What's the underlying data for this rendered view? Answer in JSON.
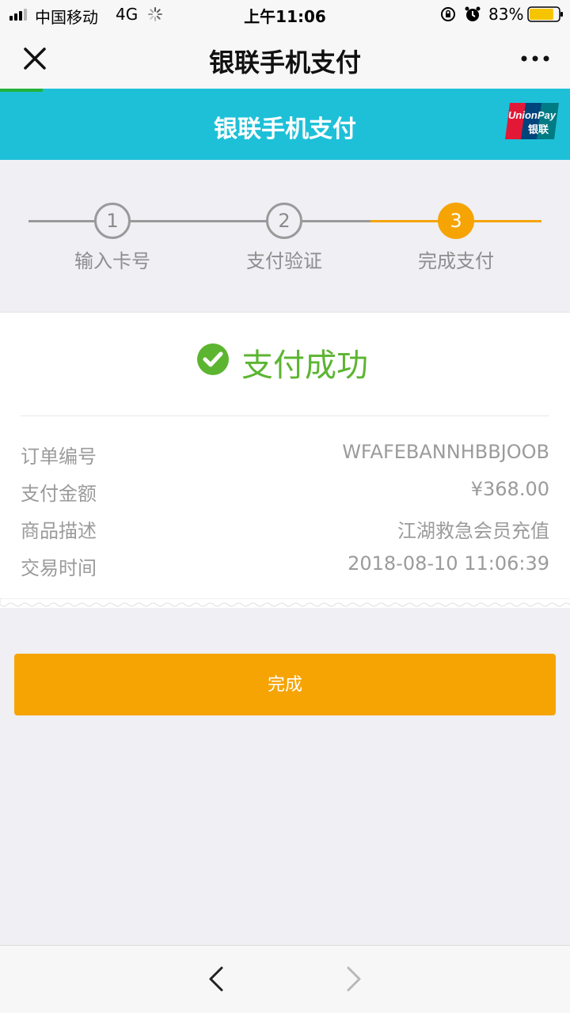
{
  "status_bar": {
    "carrier": "中国移动",
    "network": "4G",
    "time": "上午11:06",
    "battery_percent": "83%",
    "battery_level": 0.83
  },
  "nav": {
    "title": "银联手机支付",
    "close_icon": "close-icon",
    "more_icon": "more-dots-icon"
  },
  "banner": {
    "title": "银联手机支付",
    "logo_text": [
      "UnionPay",
      "银联"
    ],
    "logo_colors": [
      "#e21836",
      "#00447c",
      "#007b84"
    ]
  },
  "steps": [
    {
      "number": "1",
      "label": "输入卡号",
      "state": "done"
    },
    {
      "number": "2",
      "label": "支付验证",
      "state": "done"
    },
    {
      "number": "3",
      "label": "完成支付",
      "state": "active"
    }
  ],
  "result": {
    "status_text": "支付成功",
    "status_icon": "check-circle-icon",
    "rows": [
      {
        "label": "订单编号",
        "value": "WFAFEBANNHBBJOOB"
      },
      {
        "label": "支付金额",
        "value": "¥368.00"
      },
      {
        "label": "商品描述",
        "value": "江湖救急会员充值"
      },
      {
        "label": "交易时间",
        "value": "2018-08-10 11:06:39"
      }
    ]
  },
  "done_button": {
    "label": "完成"
  },
  "colors": {
    "banner": "#1ec0d8",
    "accent": "#f6a404",
    "success": "#5cb531",
    "load_progress": "#22b33a"
  }
}
